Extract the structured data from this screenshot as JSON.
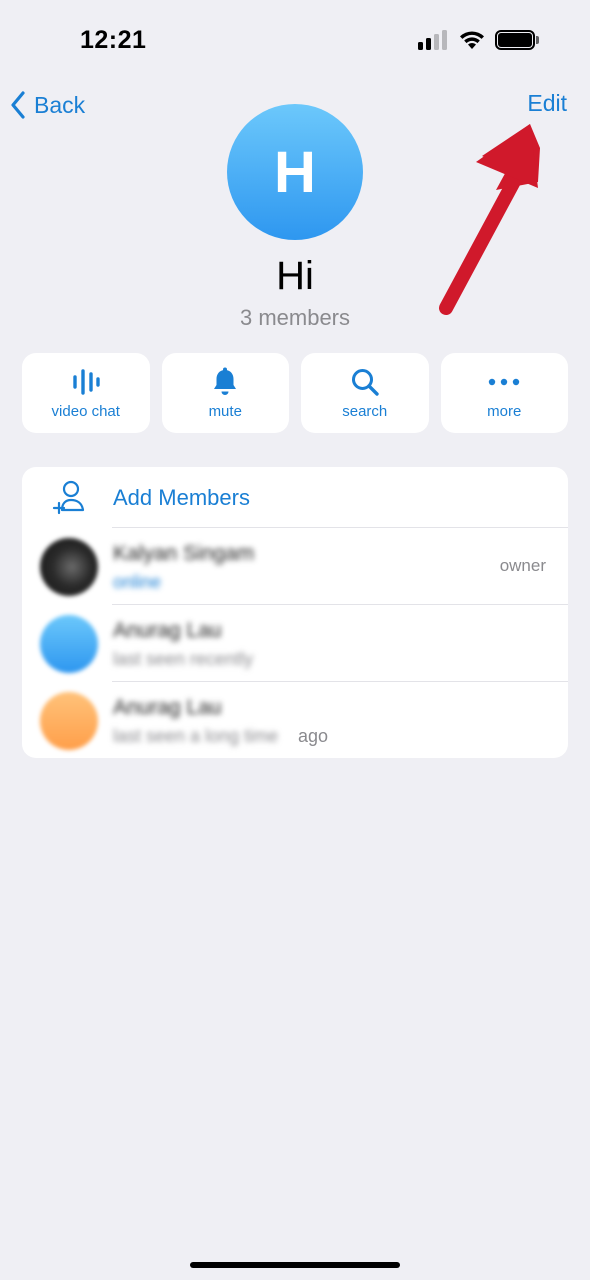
{
  "status_bar": {
    "time": "12:21",
    "signal_bars_active": 2,
    "battery_level": 1.0
  },
  "nav": {
    "back_label": "Back",
    "edit_label": "Edit"
  },
  "group": {
    "avatar_letter": "H",
    "title": "Hi",
    "subtitle": "3 members"
  },
  "actions": [
    {
      "label": "video chat",
      "icon": "video-chat-icon"
    },
    {
      "label": "mute",
      "icon": "bell-icon"
    },
    {
      "label": "search",
      "icon": "search-icon"
    },
    {
      "label": "more",
      "icon": "more-icon"
    }
  ],
  "members": {
    "add_label": "Add Members",
    "add_icon": "add-member-icon",
    "list": [
      {
        "name": "Kalyan Singam",
        "status": "online",
        "role": "owner"
      },
      {
        "name": "Anurag Lau",
        "status": "last seen recently",
        "role": ""
      },
      {
        "name": "Anurag Lau",
        "status": "last seen a long time",
        "status_tail": "ago",
        "role": ""
      }
    ]
  },
  "colors": {
    "accent": "#1a7fd4",
    "background": "#efeff4",
    "annotation": "#d0192b",
    "avatar_gradient_top": "#6cc8fb",
    "avatar_gradient_bottom": "#2e97f0"
  }
}
